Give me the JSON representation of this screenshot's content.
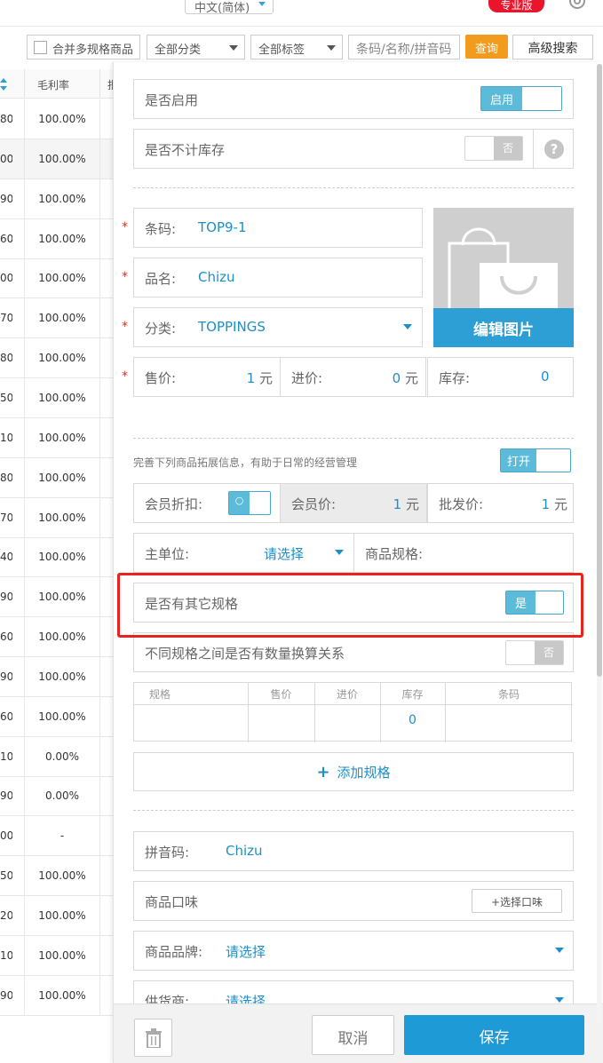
{
  "header": {
    "language": "中文(简体)",
    "pro_badge": "专业版"
  },
  "toolbar": {
    "merge_label": "合并多规格商品",
    "category": "全部分类",
    "tag": "全部标签",
    "search_placeholder": "条码/名称/拼音码",
    "query": "查询",
    "advanced": "高级搜索"
  },
  "table": {
    "col_margin": "毛利率",
    "col_cut": "批",
    "rows": [
      {
        "a": "80",
        "b": "100.00%"
      },
      {
        "a": "00",
        "b": "100.00%"
      },
      {
        "a": "90",
        "b": "100.00%"
      },
      {
        "a": "60",
        "b": "100.00%"
      },
      {
        "a": "00",
        "b": "100.00%"
      },
      {
        "a": "70",
        "b": "100.00%"
      },
      {
        "a": "80",
        "b": "100.00%"
      },
      {
        "a": "50",
        "b": "100.00%"
      },
      {
        "a": "10",
        "b": "100.00%"
      },
      {
        "a": "80",
        "b": "100.00%"
      },
      {
        "a": "70",
        "b": "100.00%"
      },
      {
        "a": "40",
        "b": "100.00%"
      },
      {
        "a": "90",
        "b": "100.00%"
      },
      {
        "a": "60",
        "b": "100.00%"
      },
      {
        "a": "90",
        "b": "100.00%"
      },
      {
        "a": "60",
        "b": "100.00%"
      },
      {
        "a": "10",
        "b": "0.00%"
      },
      {
        "a": "90",
        "b": "0.00%"
      },
      {
        "a": "00",
        "b": "-"
      },
      {
        "a": "50",
        "b": "100.00%"
      },
      {
        "a": "20",
        "b": "100.00%"
      },
      {
        "a": "10",
        "b": "100.00%"
      },
      {
        "a": "90",
        "b": "100.00%"
      }
    ]
  },
  "form": {
    "enabled_label": "是否启用",
    "enabled_toggle": "启用",
    "no_stock_label": "是否不计库存",
    "no_stock_toggle": "否",
    "barcode_label": "条码:",
    "barcode_value": "TOP9-1",
    "name_label": "品名:",
    "name_value": "Chizu",
    "category_label": "分类:",
    "category_value": "TOPPINGS",
    "edit_image": "编辑图片",
    "price_label": "售价:",
    "price_value": "1",
    "purchase_label": "进价:",
    "purchase_value": "0",
    "unit": "元",
    "stock_label": "库存:",
    "stock_value": "0",
    "extend_hint": "完善下列商品拓展信息，有助于日常的经营管理",
    "extend_toggle": "打开",
    "member_discount_label": "会员折扣:",
    "member_discount_toggle": "○",
    "member_price_label": "会员价:",
    "member_price_value": "1",
    "wholesale_label": "批发价:",
    "wholesale_value": "1",
    "main_unit_label": "主单位:",
    "main_unit_value": "请选择",
    "spec_label": "商品规格:",
    "other_spec_label": "是否有其它规格",
    "other_spec_toggle": "是",
    "convert_label": "不同规格之间是否有数量换算关系",
    "convert_toggle": "否",
    "spec_table": {
      "headers": [
        "规格",
        "售价",
        "进价",
        "库存",
        "条码"
      ],
      "stock_value": "0"
    },
    "add_spec": "添加规格",
    "pinyin_label": "拼音码:",
    "pinyin_value": "Chizu",
    "taste_label": "商品口味",
    "taste_button": "+选择口味",
    "brand_label": "商品品牌:",
    "brand_value": "请选择",
    "supplier_label": "供货商:",
    "supplier_value": "请选择"
  },
  "footer": {
    "cancel": "取消",
    "save": "保存"
  },
  "colors": {
    "accent": "#1e9ad6",
    "orange": "#f29c1f",
    "highlight": "#e8231c",
    "badge": "#e8152c"
  }
}
